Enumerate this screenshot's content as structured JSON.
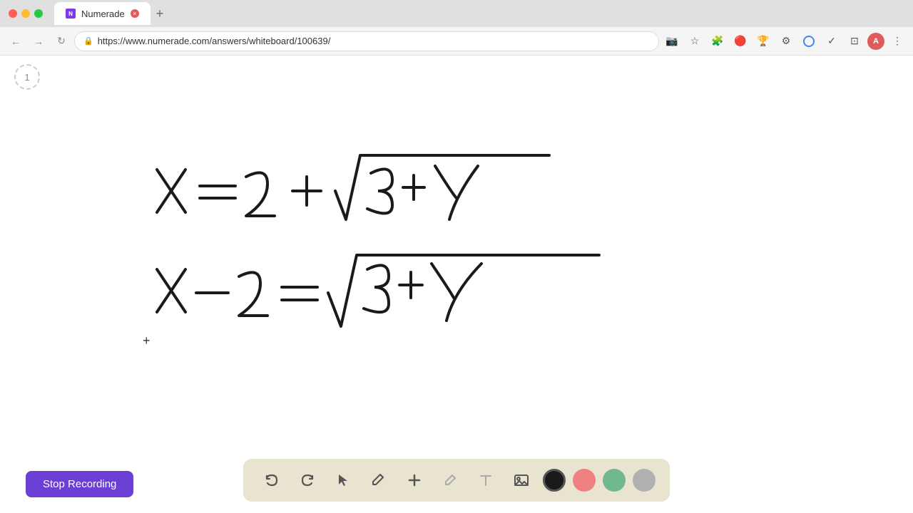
{
  "browser": {
    "tab_title": "Numerade",
    "tab_url": "https://www.numerade.com/answers/whiteboard/100639/",
    "favicon_letter": "N",
    "profile_letter": "A"
  },
  "toolbar": {
    "back": "←",
    "forward": "→",
    "refresh": "↻",
    "bookmark": "☆",
    "menu": "⋮"
  },
  "page": {
    "number": "1"
  },
  "math": {
    "line1": "x = 2 + √(3+y)",
    "line2": "x - 2 = √(3+y)"
  },
  "bottom_toolbar": {
    "undo_label": "↺",
    "redo_label": "↻",
    "select_label": "▲",
    "pen_label": "✏",
    "add_label": "+",
    "highlighter_label": "/",
    "text_label": "A",
    "image_label": "🖼",
    "colors": [
      "#1a1a1a",
      "#f08080",
      "#70b88e",
      "#b0b0b0"
    ]
  },
  "stop_recording": {
    "label": "Stop Recording",
    "bg_color": "#6b3fd4"
  }
}
